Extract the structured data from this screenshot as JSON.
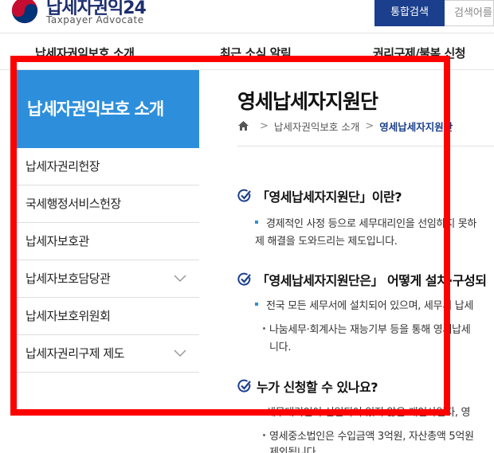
{
  "header": {
    "logo_title": "납세자권익24",
    "logo_sub": "Taxpayer Advocate",
    "search_button": "통합검색",
    "search_placeholder": "검색어를"
  },
  "gnb": [
    {
      "label": "납세자권익보호 소개"
    },
    {
      "label": "최근 소식 알림"
    },
    {
      "label": "권리구제/불복 신청"
    }
  ],
  "sidebar": {
    "title": "납세자권익보호 소개",
    "items": [
      {
        "label": "납세자권리헌장",
        "expandable": false
      },
      {
        "label": "국세행정서비스헌장",
        "expandable": false
      },
      {
        "label": "납세자보호관",
        "expandable": false
      },
      {
        "label": "납세자보호담당관",
        "expandable": true
      },
      {
        "label": "납세자보호위원회",
        "expandable": false
      },
      {
        "label": "납세자권리구제 제도",
        "expandable": true
      }
    ]
  },
  "content": {
    "page_title": "영세납세자지원단",
    "breadcrumb": [
      "납세자권익보호 소개",
      "영세납세자지원단"
    ],
    "sections": [
      {
        "title": "「영세납세자지원단」이란?",
        "line1": "경제적인 사정 등으로 세무대리인을 선임하지 못하",
        "line2": "제 해결을 도와드리는 제도입니다."
      },
      {
        "title": "「영세납세자지원단은」 어떻게 설치·구성되",
        "line1": "전국 모든 세무서에 설치되어 있으며, 세무서 납세",
        "sub1": "나눔세무·회계사는 재능기부 등을 통해 영세납세",
        "sub2": "니다."
      },
      {
        "title": "누가 신청할 수 있나요?",
        "line1": "세무대리인이 선임되어 있지 않은 개인사업자, 영",
        "sub1": "영세중소법인은 수입금액 3억원, 자산총액 5억원",
        "sub2": "제외됩니다"
      }
    ]
  },
  "colors": {
    "brand_navy": "#1b3f8c",
    "sidebar_blue": "#2d8fdc",
    "highlight_red": "#ff0000"
  }
}
